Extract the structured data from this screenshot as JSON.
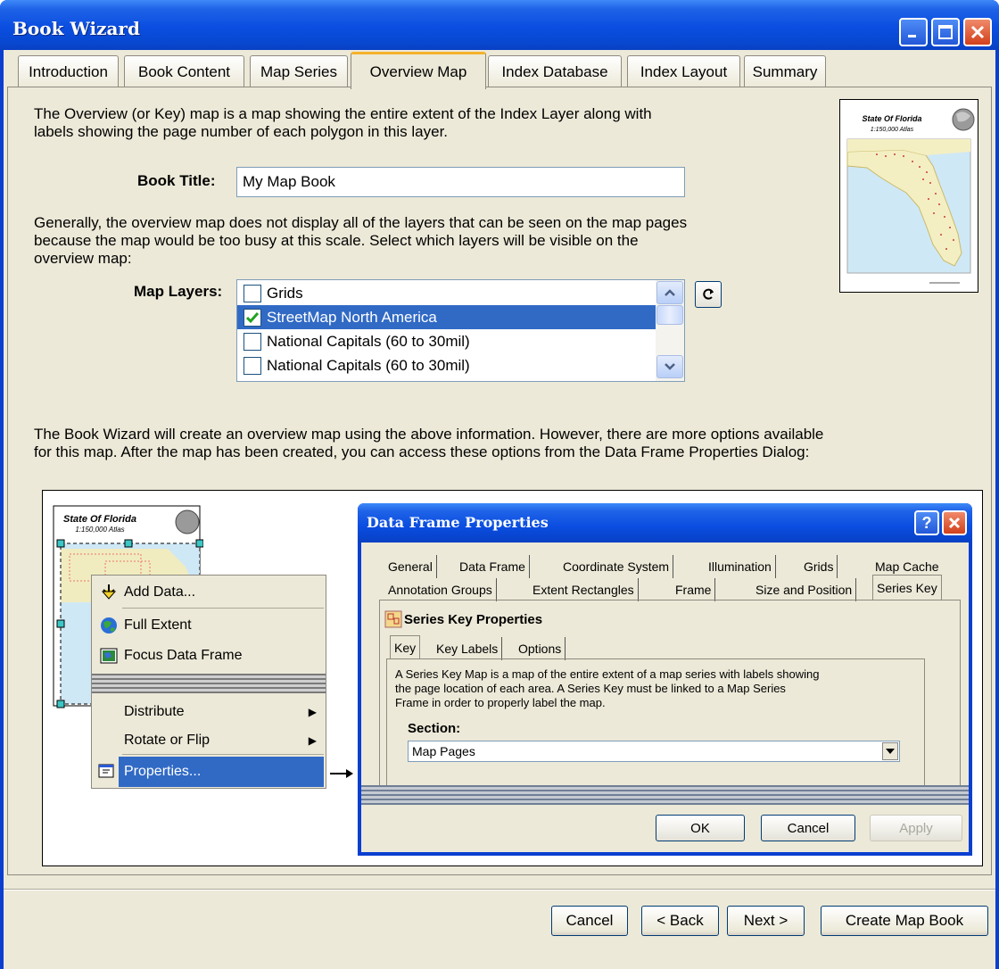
{
  "window": {
    "title": "Book Wizard"
  },
  "tabs": [
    {
      "label": "Introduction"
    },
    {
      "label": "Book Content"
    },
    {
      "label": "Map Series"
    },
    {
      "label": "Overview Map"
    },
    {
      "label": "Index Database"
    },
    {
      "label": "Index Layout"
    },
    {
      "label": "Summary"
    }
  ],
  "active_tab": "Overview Map",
  "intro": {
    "line1": "The Overview (or Key) map is a map showing the entire extent of the Index Layer along with",
    "line2": "labels showing the page number of each polygon in this layer."
  },
  "book_title": {
    "label": "Book Title:",
    "value": "My Map Book"
  },
  "layers_desc": {
    "line1": "Generally, the overview map does not display all of the layers that can be seen on the map pages",
    "line2": "because the map would be too busy at this scale.  Select which layers will be visible on the",
    "line3": "overview map:"
  },
  "map_layers": {
    "label": "Map Layers:",
    "items": [
      {
        "label": "Grids",
        "checked": false
      },
      {
        "label": "StreetMap North America",
        "checked": true
      },
      {
        "label": "National Capitals (60 to 30mil)",
        "checked": false
      },
      {
        "label": "National Capitals (60 to 30mil)",
        "checked": false
      }
    ],
    "selected_index": 1
  },
  "thumbnail": {
    "title": "State Of Florida",
    "subtitle": "1:150,000 Atlas"
  },
  "options_desc": {
    "line1": "The Book Wizard will create an overview map using the above information.  However, there are more options available",
    "line2": "for this map.  After the map has been created, you can access these options from the Data Frame Properties Dialog:"
  },
  "illustration": {
    "mini_title": "State Of Florida",
    "mini_subtitle": "1:150,000 Atlas",
    "context_menu": [
      {
        "label": "Add Data...",
        "icon": "add-data-icon"
      },
      {
        "label": "Full Extent",
        "icon": "globe-icon"
      },
      {
        "label": "Focus Data Frame",
        "icon": "focus-frame-icon"
      },
      {
        "label": "Distribute",
        "submenu": true
      },
      {
        "label": "Rotate or Flip",
        "submenu": true
      },
      {
        "label": "Properties...",
        "icon": "properties-icon",
        "selected": true
      }
    ],
    "dialog": {
      "title": "Data Frame Properties",
      "tabs_row1": [
        "General",
        "Data Frame",
        "Coordinate System",
        "Illumination",
        "Grids",
        "Map Cache"
      ],
      "tabs_row2": [
        "Annotation Groups",
        "Extent Rectangles",
        "Frame",
        "Size and Position",
        "Series Key"
      ],
      "active_tab": "Series Key",
      "section_heading": "Series Key Properties",
      "subtabs": [
        "Key",
        "Key Labels",
        "Options"
      ],
      "description_line1": "A Series Key Map is a map of the entire extent of a map series with labels showing",
      "description_line2": "the page location of each area.  A Series Key must be linked to a Map Series",
      "description_line3": "Frame in order to properly label the map.",
      "section_label": "Section:",
      "section_value": "Map Pages",
      "buttons": {
        "ok": "OK",
        "cancel": "Cancel",
        "apply": "Apply"
      }
    }
  },
  "footer": {
    "cancel": "Cancel",
    "back": "< Back",
    "next": "Next >",
    "create": "Create Map Book"
  },
  "colors": {
    "title_bar": "#0a4de0",
    "selection": "#316ac5",
    "face": "#ece9d8",
    "active_tab_accent": "#f5b22c"
  }
}
